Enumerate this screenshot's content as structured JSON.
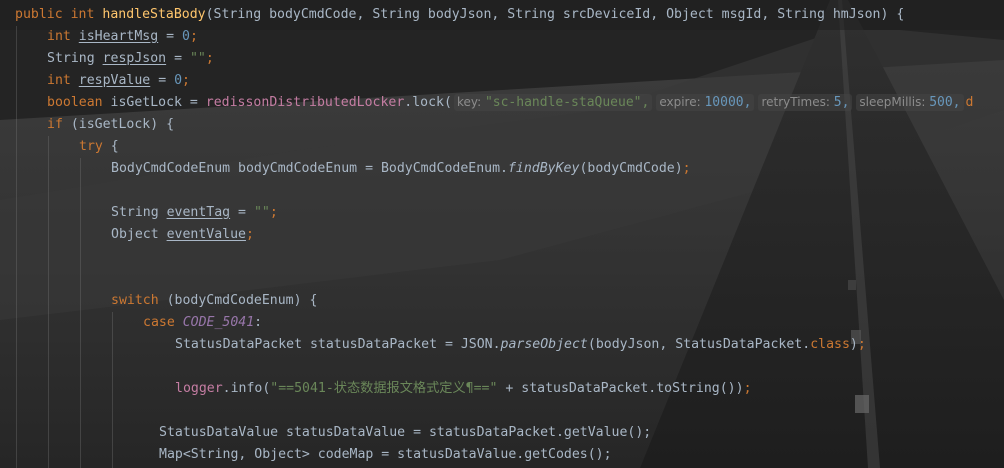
{
  "lines": {
    "l1": {
      "kw1": "public",
      "kw2": "int",
      "fname": "handleStaBody",
      "rest": "(String bodyCmdCode, String bodyJson, String srcDeviceId, Object msgId, String hmJson) {"
    },
    "l2": {
      "type": "int",
      "var": "isHeartMsg",
      "eq": " = ",
      "val": "0",
      "semi": ";"
    },
    "l3": {
      "type": "String",
      "var": "respJson",
      "eq": " = ",
      "val": "\"\"",
      "semi": ";"
    },
    "l4": {
      "type": "int",
      "var": "respValue",
      "eq": " = ",
      "val": "0",
      "semi": ";"
    },
    "l5": {
      "type": "boolean",
      "decl": " isGetLock = ",
      "call": "redissonDistributedLocker",
      "method": ".lock(",
      "hint1_name": "key:",
      "hint1_val": "\"sc-handle-staQueue\",",
      "hint2_name": "expire:",
      "hint2_val": "10000,",
      "hint3_name": "retryTimes:",
      "hint3_val": "5,",
      "hint4_name": "sleepMillis:",
      "hint4_val": "500,",
      "tail": "d"
    },
    "l6": {
      "kw": "if",
      "rest": " (isGetLock) {"
    },
    "l7": {
      "kw": "try",
      "rest": " {"
    },
    "l8": {
      "pre": "BodyCmdCodeEnum bodyCmdCodeEnum = BodyCmdCodeEnum.",
      "method": "findByKey",
      "post": "(bodyCmdCode)",
      "semi": ";"
    },
    "l9": {
      "type": "String ",
      "var": "eventTag",
      "eq": " = ",
      "val": "\"\"",
      "semi": ";"
    },
    "l10": {
      "type": "Object ",
      "var": "eventValue",
      "semi": ";"
    },
    "l11": {
      "kw": "switch",
      "rest": " (bodyCmdCodeEnum) {"
    },
    "l12": {
      "kw": "case ",
      "field": "CODE_5041",
      "colon": ":"
    },
    "l13": {
      "pre": "StatusDataPacket statusDataPacket = JSON.",
      "method": "parseObject",
      "mid": "(bodyJson, StatusDataPacket.",
      "kw": "class",
      "post": ")",
      "semi": ";"
    },
    "l14": {
      "logger": "logger",
      "pre": ".info(",
      "str": "\"==5041-状态数据报文格式定义¶==\"",
      "post": " + statusDataPacket.toString())",
      "semi": ";"
    },
    "l15": {
      "text": "StatusDataValue statusDataValue = statusDataPacket.getValue();"
    },
    "l16": {
      "text": "Map<String, Object> codeMap = statusDataValue.getCodes();"
    }
  },
  "colors": {
    "keyword": "#cc7832",
    "function": "#ffc66d",
    "string": "#6a8759",
    "number": "#6897bb",
    "field": "#9876aa",
    "text": "#a9b7c6"
  }
}
